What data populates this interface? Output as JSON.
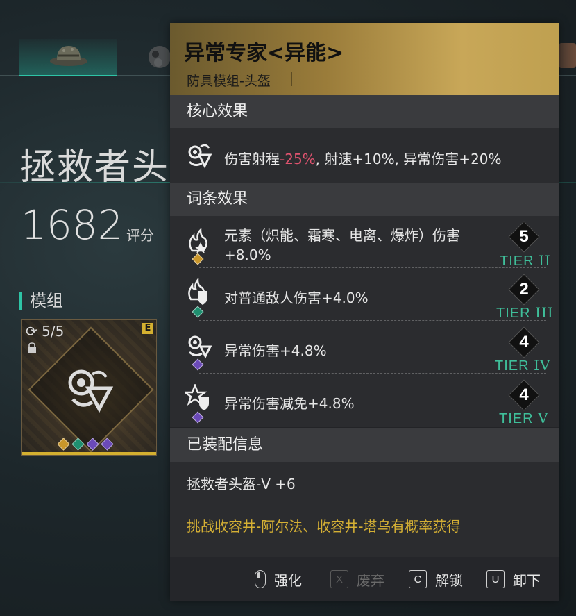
{
  "background": {
    "title": "拯救者头",
    "score": "1682",
    "score_label": "评分",
    "section_label": "模组",
    "module_card": {
      "count": "5/5",
      "grade_badge": "E",
      "gem_colors": [
        "#c9962a",
        "#1f9070",
        "#6b4ab8",
        "#6b4ab8"
      ]
    }
  },
  "panel": {
    "title": "异常专家<异能>",
    "subtitle": "防具模组-头盔",
    "core": {
      "heading": "核心效果",
      "text_prefix": "伤害射程",
      "text_negative": "-25%",
      "text_suffix": ", 射速+10%, 异常伤害+20%"
    },
    "affixes": {
      "heading": "词条效果",
      "items": [
        {
          "text": "元素（炽能、霜寒、电离、爆炸）伤害+8.0%",
          "tier_level": "5",
          "tier_prefix": "TIER",
          "tier_roman": "II",
          "gem_color": "#c9962a",
          "icon": "flame-star-icon"
        },
        {
          "text": "对普通敌人伤害+4.0%",
          "tier_level": "2",
          "tier_prefix": "TIER",
          "tier_roman": "III",
          "gem_color": "#1f9070",
          "icon": "flame-shield-icon"
        },
        {
          "text": "异常伤害+4.8%",
          "tier_level": "4",
          "tier_prefix": "TIER",
          "tier_roman": "IV",
          "gem_color": "#6b4ab8",
          "icon": "swirl-icon"
        },
        {
          "text": "异常伤害减免+4.8%",
          "tier_level": "4",
          "tier_prefix": "TIER",
          "tier_roman": "V",
          "gem_color": "#6b4ab8",
          "icon": "star-shield-icon"
        }
      ]
    },
    "equipped": {
      "heading": "已装配信息",
      "name": "拯救者头盔-V +6",
      "source": "挑战收容井-阿尔法、收容井-塔乌有概率获得"
    },
    "actions": {
      "enhance": {
        "key": "mouse",
        "label": "强化"
      },
      "discard": {
        "key": "X",
        "label": "废弃"
      },
      "unlock": {
        "key": "C",
        "label": "解锁"
      },
      "unequip": {
        "key": "U",
        "label": "卸下"
      }
    }
  },
  "colors": {
    "accent": "#2ec4a6",
    "header_gold": "#c8a758",
    "tier_green": "#3fbf9a",
    "negative": "#e0536f",
    "source_yellow": "#d5b034"
  }
}
